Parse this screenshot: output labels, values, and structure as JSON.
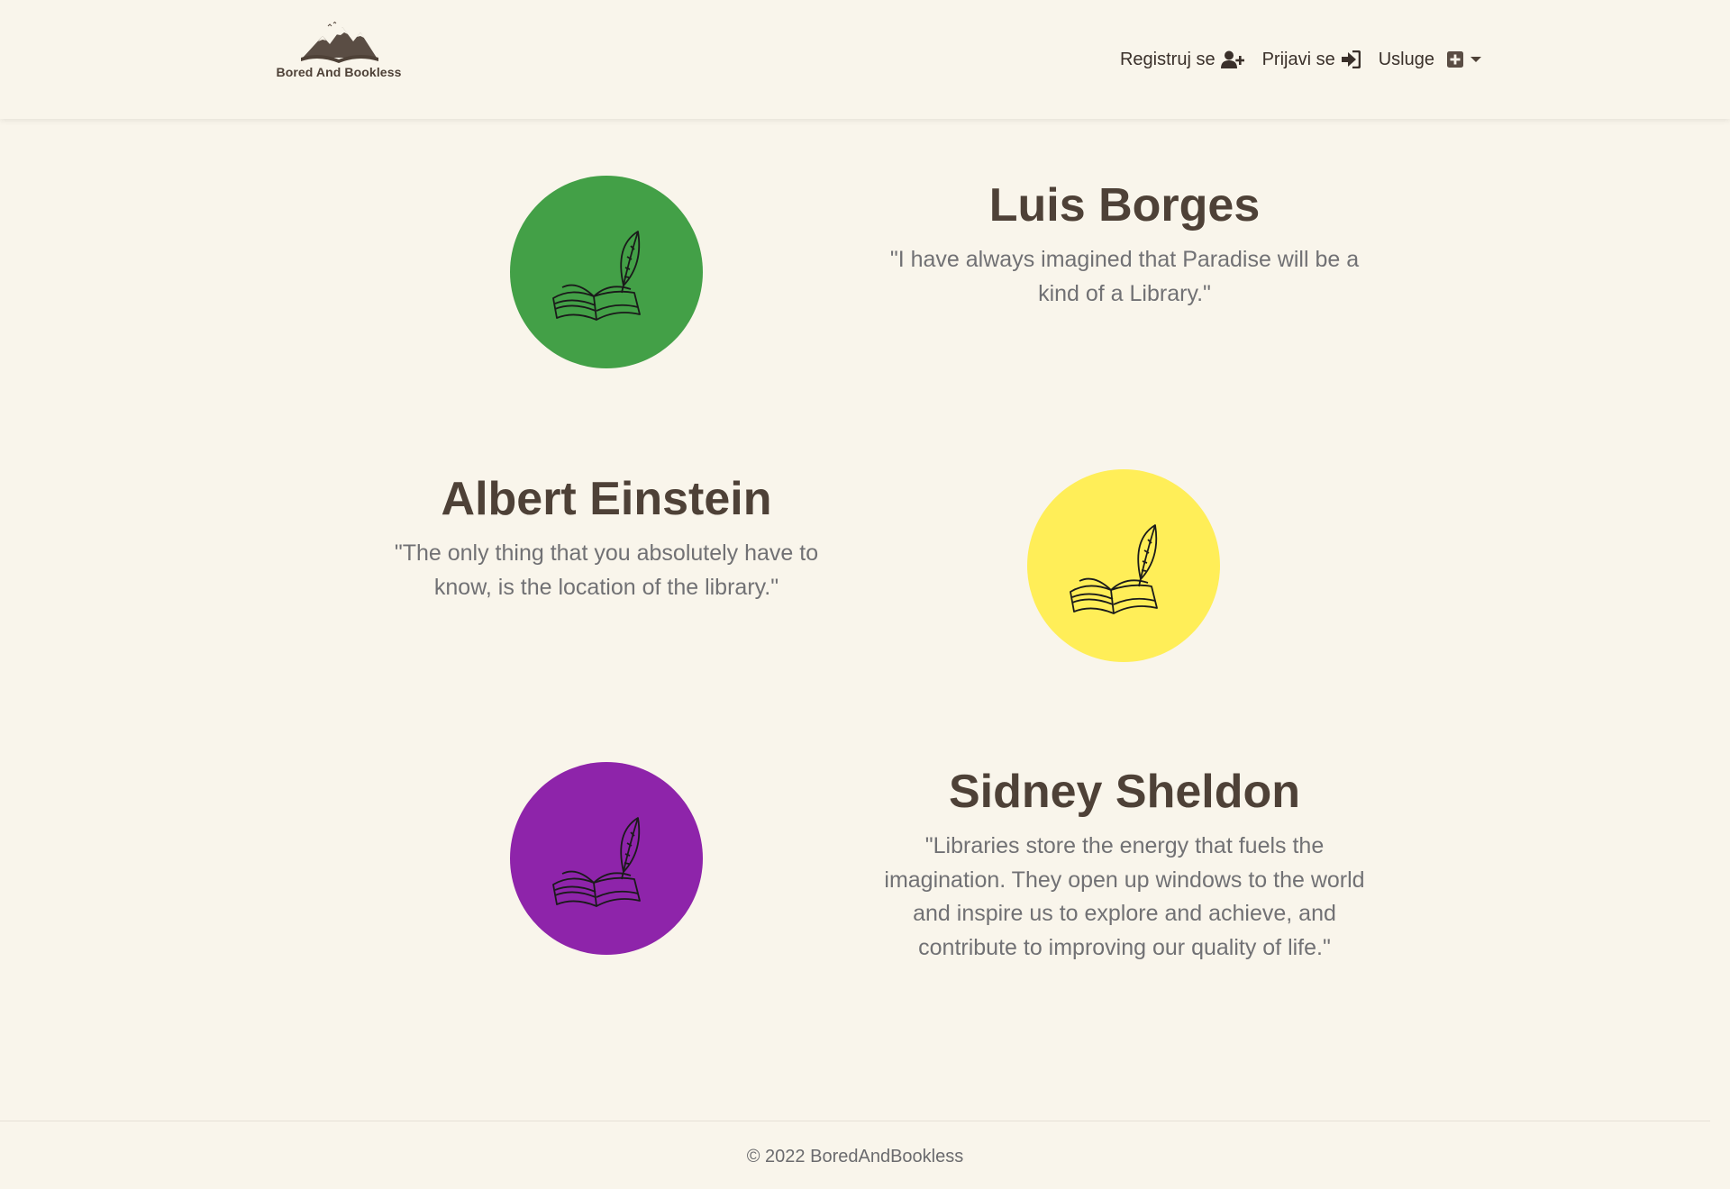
{
  "brand": {
    "name": "Bored And Bookless"
  },
  "nav": {
    "register_label": "Registruj se",
    "login_label": "Prijavi se",
    "services_label": "Usluge"
  },
  "features": [
    {
      "author": "Luis Borges",
      "quote": "\"I have always imagined that Paradise will be a kind of a Library.\"",
      "circle_color": "#43a047"
    },
    {
      "author": "Albert Einstein",
      "quote": "\"The only thing that you absolutely have to know, is the location of the library.\"",
      "circle_color": "#ffee58"
    },
    {
      "author": "Sidney Sheldon",
      "quote": "\"Libraries store the energy that fuels the imagination. They open up windows to the world and inspire us to explore and achieve, and contribute to improving our quality of life.\"",
      "circle_color": "#8e24aa"
    }
  ],
  "footer": {
    "copyright": "© 2022 BoredAndBookless"
  },
  "colors": {
    "background": "#f9f5eb",
    "heading": "#4e4137",
    "muted_text": "#717174"
  },
  "icons": {
    "logo": "mountain-book-logo",
    "register": "user-plus-icon",
    "login": "sign-in-icon",
    "services": "plus-square-icon",
    "feature": "book-quill-icon"
  }
}
